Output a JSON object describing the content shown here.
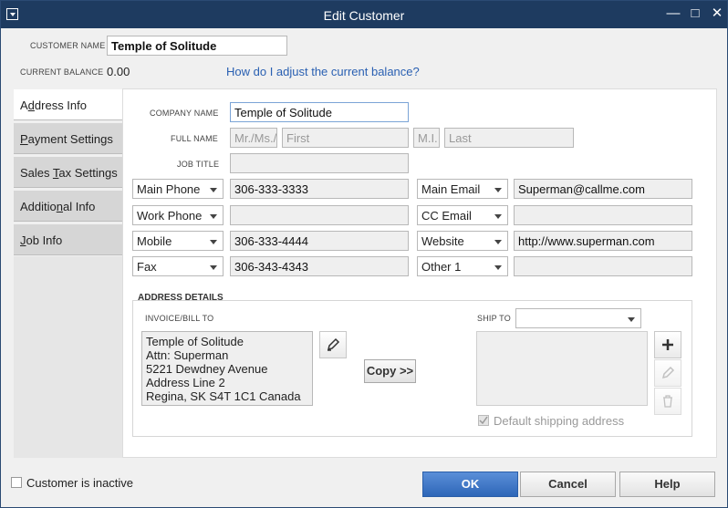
{
  "window": {
    "title": "Edit Customer"
  },
  "header": {
    "customer_name_label": "CUSTOMER NAME",
    "customer_name_value": "Temple of Solitude",
    "current_balance_label": "CURRENT BALANCE",
    "current_balance_value": "0.00",
    "adjust_balance_link": "How do I adjust the current balance?"
  },
  "tabs": [
    {
      "label_pre": "A",
      "label_ul": "d",
      "label_post": "dress Info"
    },
    {
      "label_pre": "",
      "label_ul": "P",
      "label_post": "ayment Settings"
    },
    {
      "label_pre": "Sales ",
      "label_ul": "T",
      "label_post": "ax Settings"
    },
    {
      "label_pre": "Additio",
      "label_ul": "n",
      "label_post": "al Info"
    },
    {
      "label_pre": "",
      "label_ul": "J",
      "label_post": "ob Info"
    }
  ],
  "form": {
    "company_name_label": "COMPANY NAME",
    "company_name_value": "Temple of Solitude",
    "full_name_label": "FULL NAME",
    "title_placeholder": "Mr./Ms./...",
    "first_placeholder": "First",
    "mi_placeholder": "M.I.",
    "last_placeholder": "Last",
    "job_title_label": "JOB TITLE",
    "job_title_value": "",
    "phone_rows": [
      {
        "type": "Main Phone",
        "value": "306-333-3333"
      },
      {
        "type": "Work Phone",
        "value": ""
      },
      {
        "type": "Mobile",
        "value": "306-333-4444"
      },
      {
        "type": "Fax",
        "value": "306-343-4343"
      }
    ],
    "contact_rows": [
      {
        "type": "Main Email",
        "value": "Superman@callme.com"
      },
      {
        "type": "CC Email",
        "value": ""
      },
      {
        "type": "Website",
        "value": "http://www.superman.com"
      },
      {
        "type": "Other 1",
        "value": ""
      }
    ]
  },
  "address": {
    "section_label": "ADDRESS DETAILS",
    "bill_to_label": "INVOICE/BILL TO",
    "bill_to_lines": [
      "Temple of Solitude",
      "Attn: Superman",
      "5221 Dewdney Avenue",
      "Address Line 2",
      "Regina, SK S4T 1C1 Canada"
    ],
    "copy_button": "Copy >>",
    "ship_to_label": "SHIP TO",
    "ship_to_value": "",
    "default_shipping_label": "Default shipping address"
  },
  "footer": {
    "inactive_label": "Customer is inactive",
    "ok": "OK",
    "cancel": "Cancel",
    "help": "Help"
  }
}
